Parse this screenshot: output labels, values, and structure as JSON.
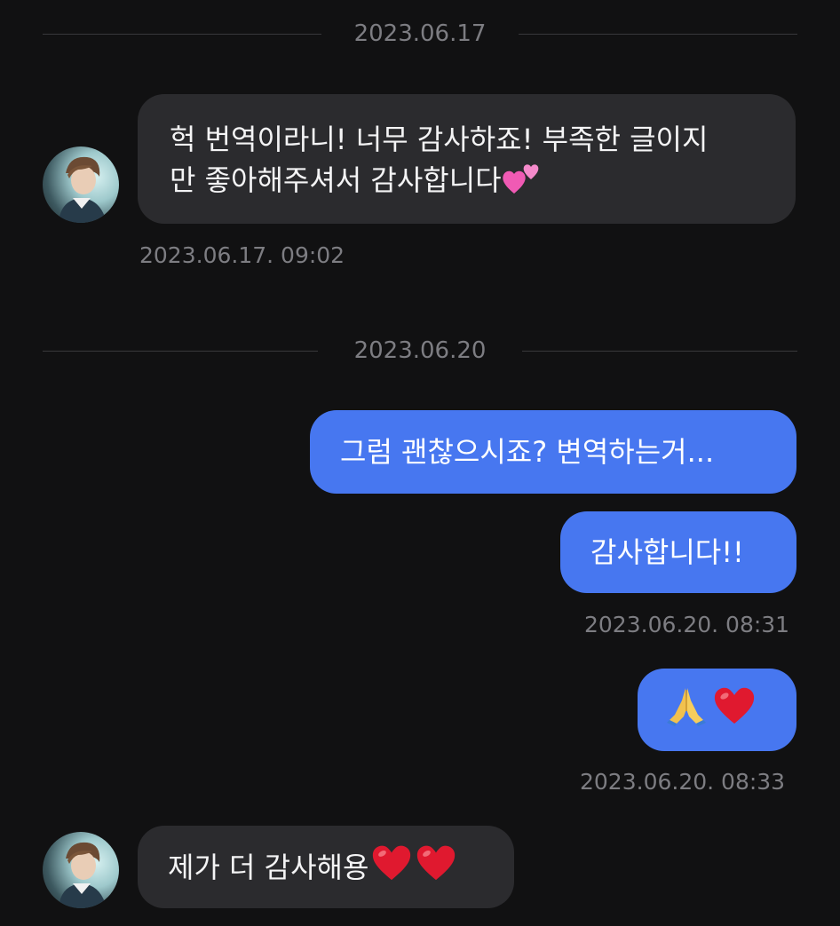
{
  "conversation": {
    "dividers": [
      {
        "date": "2023.06.17"
      },
      {
        "date": "2023.06.20"
      }
    ],
    "messages": [
      {
        "direction": "incoming",
        "lines": [
          "헉 번역이라니! 너무 감사하죠! 부족한 글이지",
          "만 좋아해주셔서 감사합니다"
        ],
        "trailing_emoji": "two-hearts-emoji",
        "timestamp": "2023.06.17. 09:02"
      },
      {
        "direction": "outgoing",
        "text": "그럼 괜찮으시죠? 변역하는거..."
      },
      {
        "direction": "outgoing",
        "text": "감사합니다!!",
        "timestamp": "2023.06.20. 08:31"
      },
      {
        "direction": "outgoing",
        "emojis": [
          "folded-hands-emoji",
          "red-heart-emoji"
        ],
        "timestamp": "2023.06.20. 08:33"
      },
      {
        "direction": "incoming",
        "text": "제가 더 감사해용",
        "trailing_emojis": [
          "red-heart-emoji",
          "red-heart-emoji"
        ]
      }
    ]
  },
  "colors": {
    "background": "#111112",
    "incoming_bubble": "#2b2b2e",
    "outgoing_bubble": "#4777f0",
    "muted_text": "#7d7d82"
  }
}
